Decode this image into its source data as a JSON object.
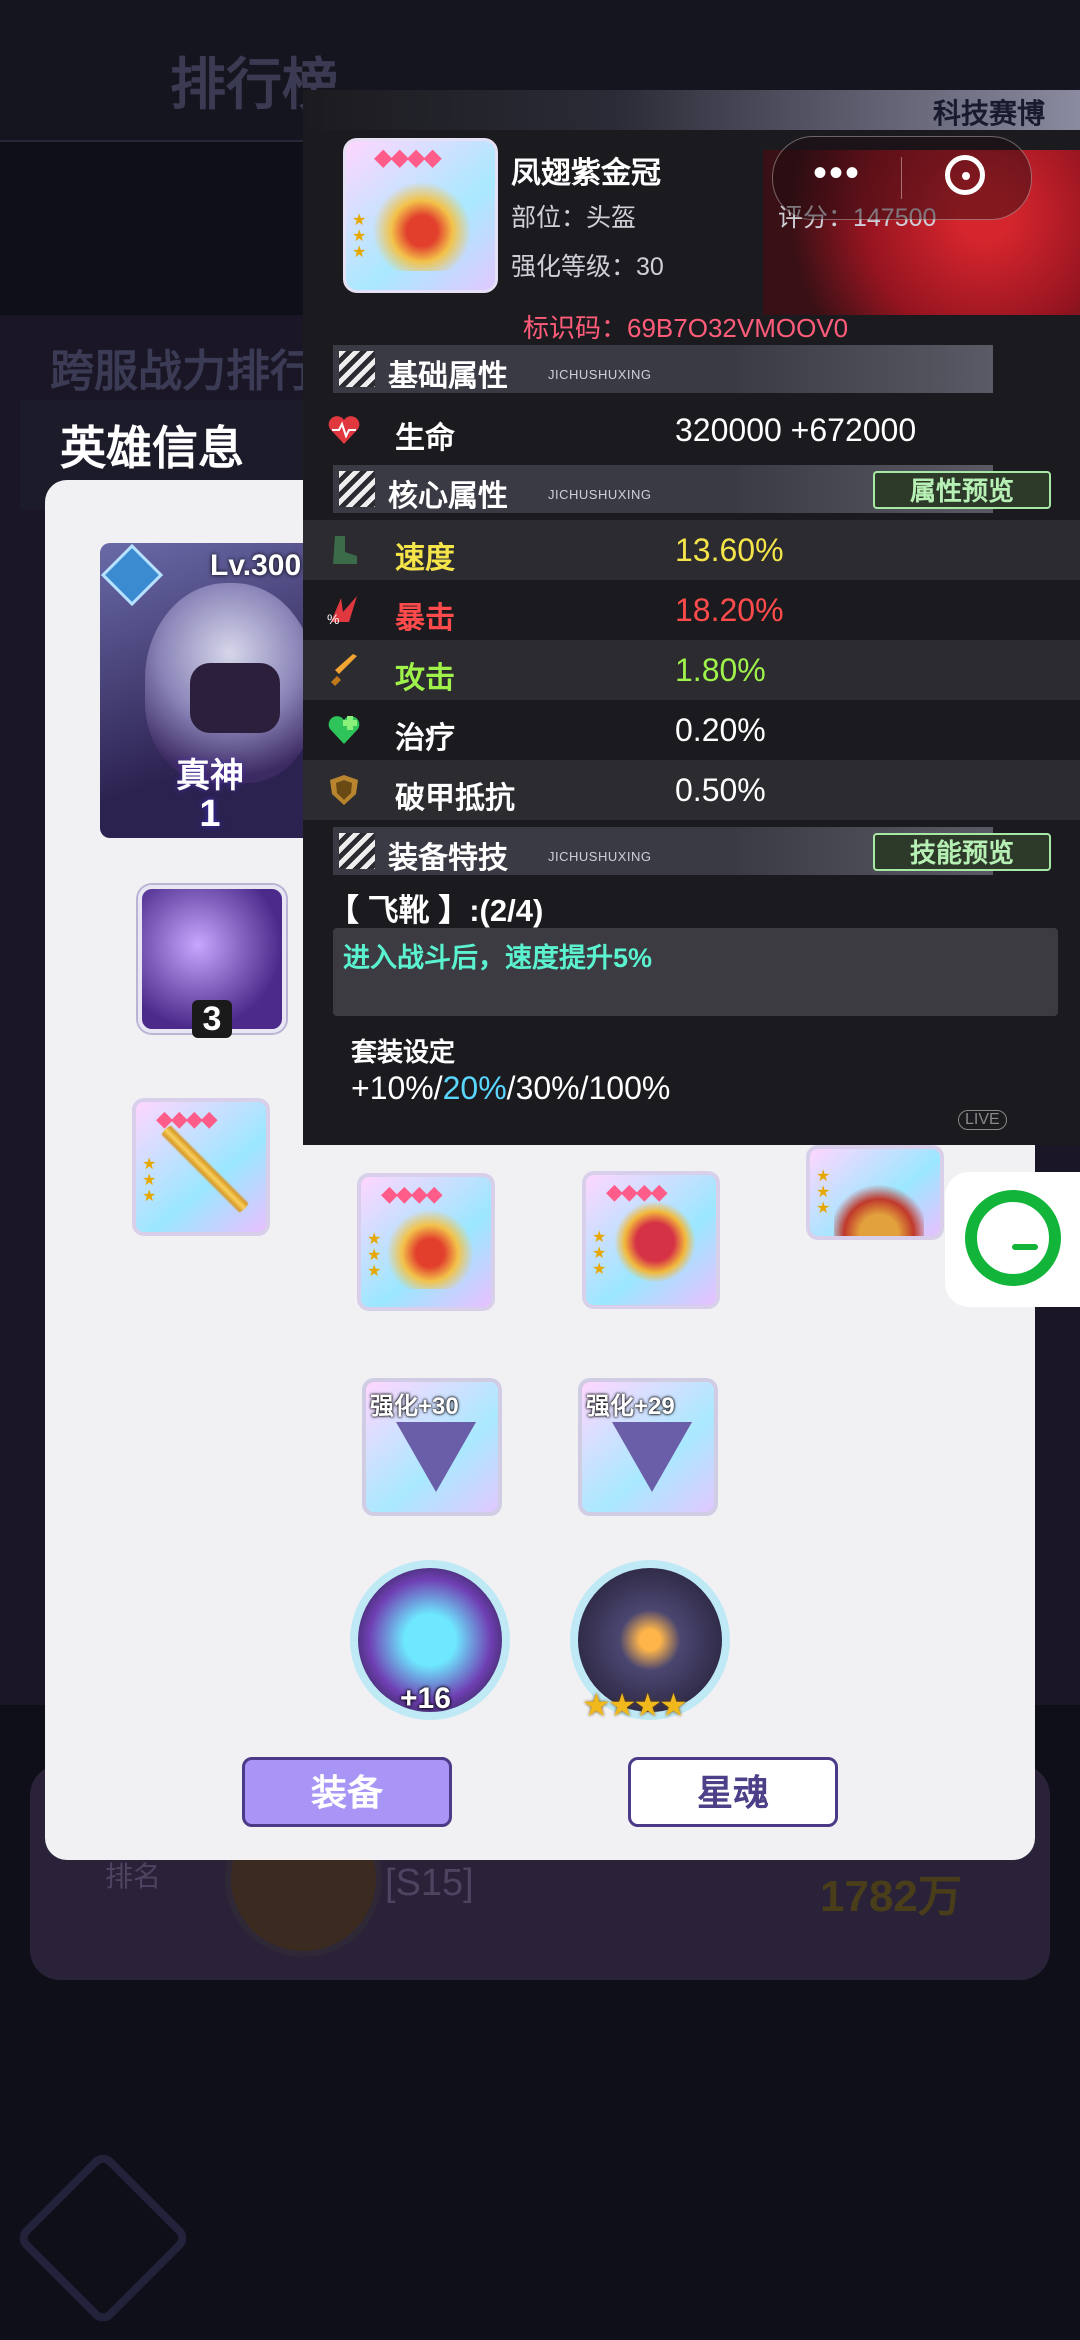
{
  "background": {
    "title": "排行榜",
    "subtitle": "跨服战力排行",
    "row": {
      "rank_tag": "排名",
      "server": "[S15]",
      "power": "1782万"
    }
  },
  "hero_panel": {
    "title": "英雄信息",
    "hero": {
      "level": "Lv.300",
      "rank_text": "真神",
      "star_count": "1"
    },
    "skill_count": "3",
    "runes": [
      "强化+30",
      "强化+29"
    ],
    "artifact_1_level": "+16",
    "artifact_2_stars": "★★★★",
    "tabs": {
      "equip": "装备",
      "star_soul": "星魂"
    }
  },
  "detail": {
    "brand": "科技赛博",
    "item_name": "凤翅紫金冠",
    "slot": "部位：头盔",
    "score": "评分：147500",
    "level": "强化等级：30",
    "code": "标识码：69B7O32VMOOV0",
    "sections": {
      "base": {
        "title": "基础属性",
        "sub": "JICHUSHUXING"
      },
      "core": {
        "title": "核心属性",
        "sub": "JICHUSHUXING"
      },
      "skill": {
        "title": "装备特技",
        "sub": "JICHUSHUXING"
      }
    },
    "buttons": {
      "attr_preview": "属性预览",
      "skill_preview": "技能预览"
    },
    "stats": {
      "hp": {
        "name": "生命",
        "value": "320000 +672000",
        "color": "#ffffff",
        "icon": "heart-icon"
      },
      "speed": {
        "name": "速度",
        "value": "13.60%",
        "color": "#f4e44a",
        "icon": "boot-icon"
      },
      "crit": {
        "name": "暴击",
        "value": "18.20%",
        "color": "#ff4b4b",
        "icon": "crit-icon"
      },
      "atk": {
        "name": "攻击",
        "value": "1.80%",
        "color": "#9ef24a",
        "icon": "sword-icon"
      },
      "heal": {
        "name": "治疗",
        "value": "0.20%",
        "color": "#ffffff",
        "icon": "heal-icon"
      },
      "pen": {
        "name": "破甲抵抗",
        "value": "0.50%",
        "color": "#ffffff",
        "icon": "shield-icon"
      }
    },
    "set": {
      "name": "【 飞靴 】:(2/4)",
      "effect": "进入战斗后，速度提升5%",
      "config_label": "套装设定",
      "tiers": [
        "+10%/",
        "20%",
        "/30%/100%"
      ]
    },
    "live": "LIVE"
  },
  "capsule": {
    "more": "•••"
  }
}
